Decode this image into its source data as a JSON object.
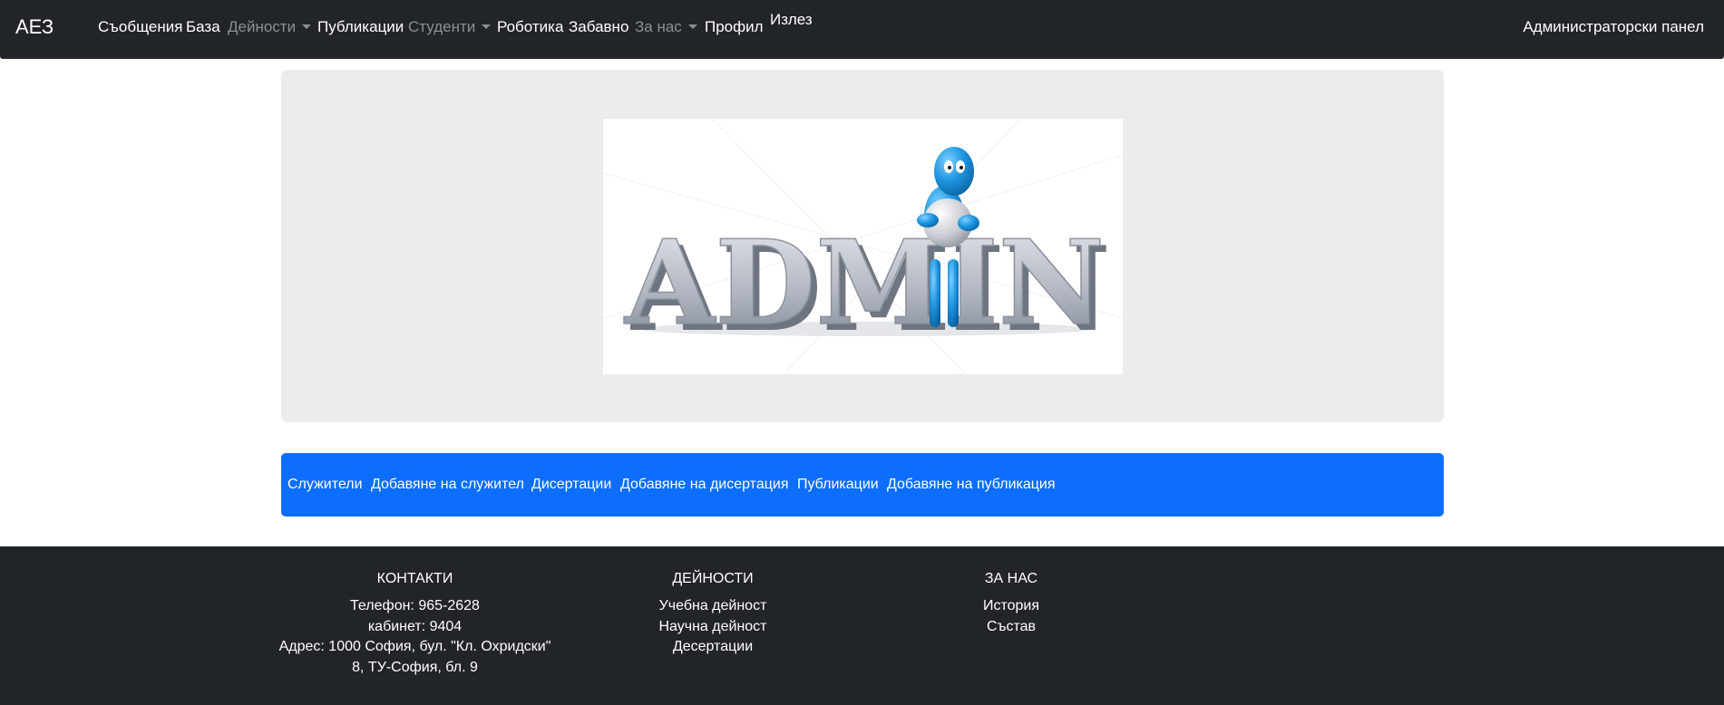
{
  "navbar": {
    "brand": "АЕЗ",
    "items": [
      {
        "label": "Съобщения",
        "muted": false,
        "dropdown": false
      },
      {
        "label": "База",
        "muted": false,
        "dropdown": false
      },
      {
        "label": "Дейности",
        "muted": true,
        "dropdown": true
      },
      {
        "label": "Публикации",
        "muted": false,
        "dropdown": false
      },
      {
        "label": "Студенти",
        "muted": true,
        "dropdown": true
      },
      {
        "label": "Роботика",
        "muted": false,
        "dropdown": false
      },
      {
        "label": "Забавно",
        "muted": false,
        "dropdown": false
      },
      {
        "label": "За нас",
        "muted": true,
        "dropdown": true
      },
      {
        "label": "Профил",
        "muted": false,
        "dropdown": false
      },
      {
        "label": "Излез",
        "muted": false,
        "dropdown": false
      }
    ],
    "admin_panel": "Администраторски панел"
  },
  "hero": {
    "image_text": "ADMIN"
  },
  "admin_links": [
    "Служители",
    "Добавяне на служител",
    "Дисертации",
    "Добавяне на дисертация",
    "Публикации",
    "Добавяне на публикация"
  ],
  "footer": {
    "contacts": {
      "heading": "КОНТАКТИ",
      "lines": [
        "Телефон: 965-2628",
        "кабинет: 9404",
        "Адрес: 1000 София, бул. \"Кл. Охридски\"",
        "8, ТУ-София, бл. 9"
      ]
    },
    "activities": {
      "heading": "ДЕЙНОСТИ",
      "links": [
        "Учебна дейност",
        "Научна дейност",
        "Десертации"
      ]
    },
    "about": {
      "heading": "ЗА НАС",
      "links": [
        "История",
        "Състав"
      ]
    }
  },
  "colors": {
    "navbar_bg": "#212529",
    "muted_nav": "#8c8f93",
    "jumbotron_bg": "#ececec",
    "primary": "#0d6efd",
    "footer_bg": "#212529"
  }
}
